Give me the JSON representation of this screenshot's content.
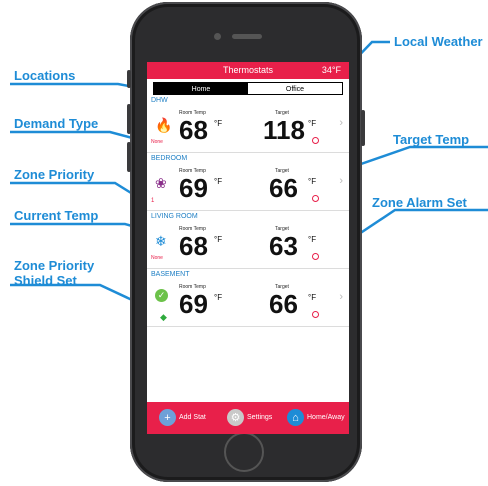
{
  "callouts": {
    "local_weather": "Local Weather",
    "locations": "Locations",
    "demand_type": "Demand Type",
    "target_temp": "Target Temp",
    "zone_priority": "Zone Priority",
    "zone_alarm_set": "Zone Alarm Set",
    "current_temp": "Current Temp",
    "zone_priority_shield_line1": "Zone Priority",
    "zone_priority_shield_line2": "Shield Set"
  },
  "header": {
    "title": "Thermostats",
    "weather": "34°F"
  },
  "locations": {
    "tabs": [
      "Home",
      "Office"
    ],
    "selected": "Home"
  },
  "zones": [
    {
      "name": "DHW",
      "room_label": "Room Temp",
      "room_temp": "68",
      "target_label": "Target",
      "target_temp": "118",
      "unit": "°F",
      "demand": "None",
      "icon": "flame-icon"
    },
    {
      "name": "BEDROOM",
      "room_label": "Room Temp",
      "room_temp": "69",
      "target_label": "Target",
      "target_temp": "66",
      "unit": "°F",
      "priority": "1",
      "icon": "fan-icon"
    },
    {
      "name": "LIVING ROOM",
      "room_label": "Room Temp",
      "room_temp": "68",
      "target_label": "Target",
      "target_temp": "63",
      "unit": "°F",
      "demand": "None",
      "icon": "snowflake-icon"
    },
    {
      "name": "BASEMENT",
      "room_label": "Room Temp",
      "room_temp": "69",
      "target_label": "Target",
      "target_temp": "66",
      "unit": "°F",
      "icon": "check-icon"
    }
  ],
  "bottom_bar": {
    "add": "Add Stat",
    "settings": "Settings",
    "home_away": "Home/Away"
  },
  "colors": {
    "accent": "#e8204a",
    "callout": "#1e8cd6",
    "zone_name": "#1e7fc4"
  }
}
